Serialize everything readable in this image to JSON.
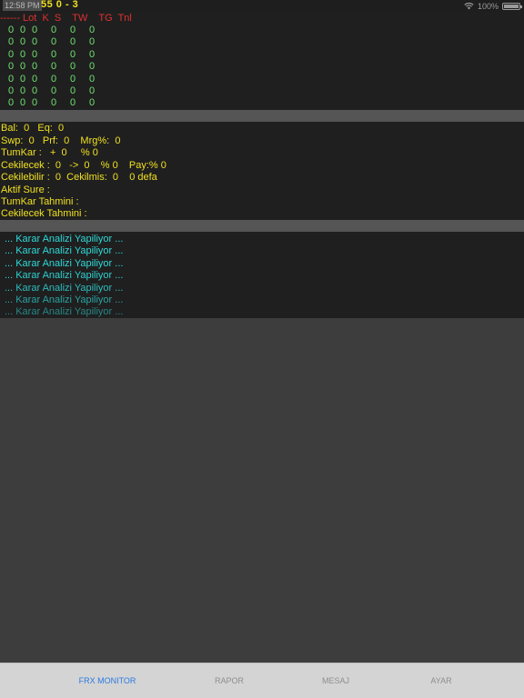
{
  "status_bar": {
    "time": "12:58 PM",
    "overlay_text": "55  0 - 3",
    "battery": "100%",
    "battery_level": 1.0
  },
  "trades": {
    "header": "------ Lot  K  S    TW    TG  Tnl",
    "columns": [
      "Lot",
      "K",
      "S",
      "TW",
      "TG",
      "Tnl"
    ],
    "rows": [
      [
        "0",
        "0",
        "0",
        "0",
        "0",
        "0"
      ],
      [
        "0",
        "0",
        "0",
        "0",
        "0",
        "0"
      ],
      [
        "0",
        "0",
        "0",
        "0",
        "0",
        "0"
      ],
      [
        "0",
        "0",
        "0",
        "0",
        "0",
        "0"
      ],
      [
        "0",
        "0",
        "0",
        "0",
        "0",
        "0"
      ],
      [
        "0",
        "0",
        "0",
        "0",
        "0",
        "0"
      ],
      [
        "0",
        "0",
        "0",
        "0",
        "0",
        "0"
      ]
    ]
  },
  "account": {
    "bal_eq": "Bal:  0   Eq:  0",
    "swp_prf_mrg": "Swp:  0   Prf:  0    Mrg%:  0",
    "tumkar": "TumKar :   +  0     % 0",
    "cekilecek": "Cekilecek :  0   ->  0    % 0    Pay:% 0",
    "cekilebilir": "Cekilebilir :  0  Cekilmis:  0    0 defa",
    "aktif_sure": "Aktif Sure :",
    "tumkar_tahmini": "TumKar Tahmini :",
    "cekilecek_tahmini": "Cekilecek Tahmini :"
  },
  "log": {
    "lines": [
      "... Karar Analizi Yapiliyor ...",
      "... Karar Analizi Yapiliyor ...",
      "... Karar Analizi Yapiliyor ...",
      "... Karar Analizi Yapiliyor ...",
      "... Karar Analizi Yapiliyor ...",
      "... Karar Analizi Yapiliyor ...",
      "... Karar Analizi Yapiliyor ..."
    ]
  },
  "tabs": {
    "items": [
      {
        "label": "FRX MONITOR",
        "active": true
      },
      {
        "label": "RAPOR",
        "active": false
      },
      {
        "label": "MESAJ",
        "active": false
      },
      {
        "label": "AYAR",
        "active": false
      }
    ]
  },
  "colors": {
    "background": "#3d3d3d",
    "panel": "#1f1f1f",
    "header_red": "#e03030",
    "trade_green": "#70e070",
    "account_yellow": "#f0e020",
    "log_cyan": "#30d8d8",
    "tab_active": "#2a7ae2",
    "tab_inactive": "#8e8e8e"
  },
  "icons": [
    "wifi-icon",
    "battery-icon"
  ]
}
